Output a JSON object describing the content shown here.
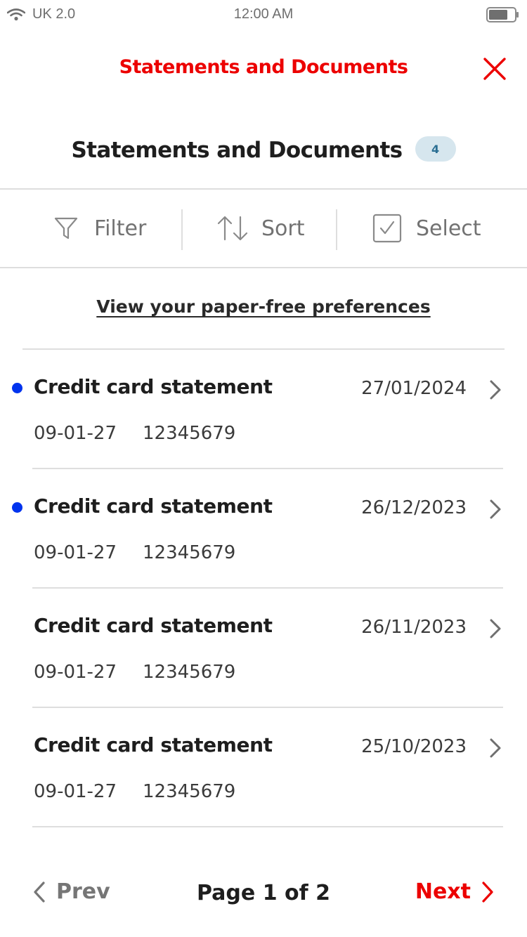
{
  "status_bar": {
    "carrier": "UK 2.0",
    "time": "12:00 AM",
    "icons": [
      "wifi-icon",
      "battery-icon"
    ]
  },
  "header": {
    "title": "Statements and Documents",
    "close_icon": "close-icon",
    "title_color": "#ec0000"
  },
  "section": {
    "title": "Statements and Documents",
    "count": "4",
    "badge_color": "#d6e6ee"
  },
  "toolbar": {
    "filter_label": "Filter",
    "sort_label": "Sort",
    "select_label": "Select",
    "icons": [
      "filter-icon",
      "sort-icon",
      "checkbox-icon"
    ]
  },
  "paper_free_link": "View your paper-free preferences",
  "statements": [
    {
      "title": "Credit card statement",
      "date": "27/01/2024",
      "sort_code": "09-01-27",
      "account": "12345679",
      "unread": true
    },
    {
      "title": "Credit card statement",
      "date": "26/12/2023",
      "sort_code": "09-01-27",
      "account": "12345679",
      "unread": true
    },
    {
      "title": "Credit card statement",
      "date": "26/11/2023",
      "sort_code": "09-01-27",
      "account": "12345679",
      "unread": false
    },
    {
      "title": "Credit card statement",
      "date": "25/10/2023",
      "sort_code": "09-01-27",
      "account": "12345679",
      "unread": false
    }
  ],
  "unread_dot_color": "#0033ee",
  "pagination": {
    "prev_label": "Prev",
    "page_label": "Page 1 of 2",
    "next_label": "Next",
    "next_color": "#ec0000"
  }
}
